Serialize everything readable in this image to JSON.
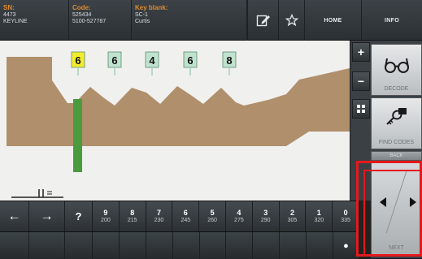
{
  "header": {
    "sn_label": "SN:",
    "sn_lines": [
      "4473",
      "KEYLINE"
    ],
    "code_label": "Code:",
    "code_lines": [
      "525434",
      "5100-527787"
    ],
    "blank_label": "Key blank:",
    "blank_lines": [
      "SC-1",
      "Curtis"
    ],
    "home_label": "HOME",
    "info_label": "INFO"
  },
  "cuts": {
    "values": [
      "6",
      "6",
      "4",
      "6",
      "8"
    ],
    "first_color": "#f2ec2e",
    "other_color": "#bfe3cf"
  },
  "colors": {
    "key": "#b08f6c",
    "shoulder": "#4a9a3e",
    "canvas": "#f0f0ee",
    "highlight": "#e4191d"
  },
  "zoom": {
    "in_label": "+",
    "out_label": "−",
    "fit_label": "⛶"
  },
  "side": {
    "decode_label": "DECODE",
    "findcodes_label": "FIND CODES",
    "back_label": "BACK",
    "next_label": "NEXT"
  },
  "depth_bar": {
    "question": "?",
    "depths": [
      {
        "n": "9",
        "v": "200"
      },
      {
        "n": "8",
        "v": "215"
      },
      {
        "n": "7",
        "v": "230"
      },
      {
        "n": "6",
        "v": "245"
      },
      {
        "n": "5",
        "v": "260"
      },
      {
        "n": "4",
        "v": "275"
      },
      {
        "n": "3",
        "v": "290"
      },
      {
        "n": "2",
        "v": "305"
      },
      {
        "n": "1",
        "v": "320"
      },
      {
        "n": "0",
        "v": "335"
      }
    ]
  },
  "bottom_bar": {
    "icon_glyph": "●"
  }
}
